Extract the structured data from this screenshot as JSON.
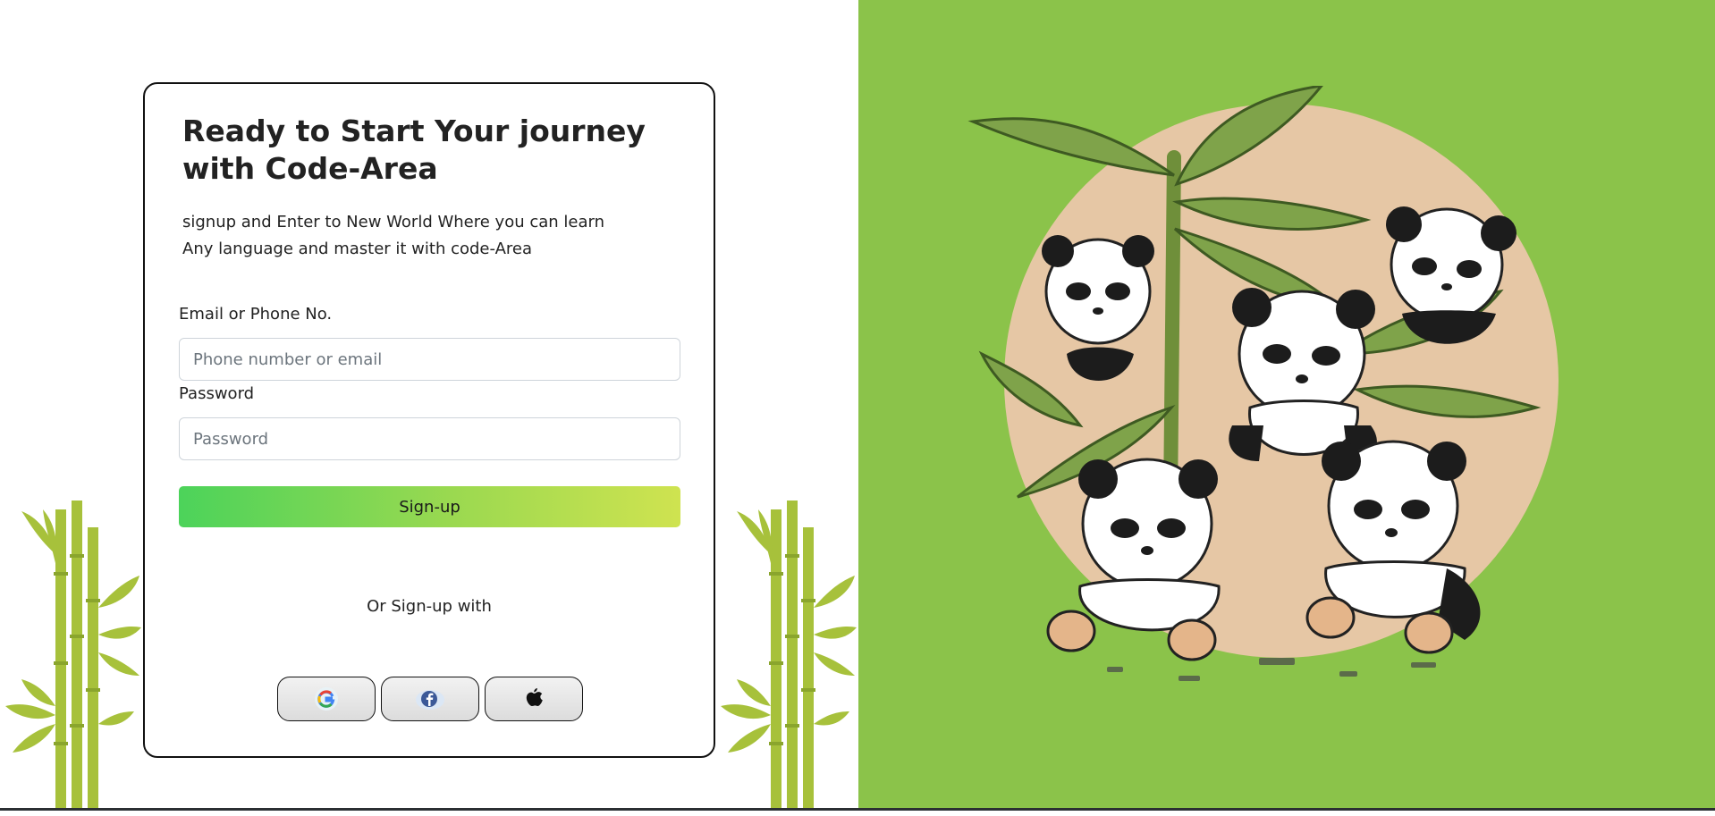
{
  "form": {
    "title": "Ready to Start Your journey with Code-Area",
    "subtitle_line1": "signup and Enter to New World Where you can learn",
    "subtitle_line2": "Any language and master it with code-Area",
    "email_label": "Email or Phone No.",
    "email_placeholder": "Phone number or email",
    "password_label": "Password",
    "password_placeholder": "Password",
    "submit_label": "Sign-up",
    "alt_signup_text": "Or Sign-up with"
  },
  "social_buttons": [
    {
      "icon": "google-icon"
    },
    {
      "icon": "facebook-icon"
    },
    {
      "icon": "apple-icon"
    }
  ],
  "colors": {
    "illustration_background": "#8bc34a",
    "button_gradient_start": "#4cd35a",
    "button_gradient_end": "#cfe350",
    "bamboo": "#a7c13b"
  }
}
